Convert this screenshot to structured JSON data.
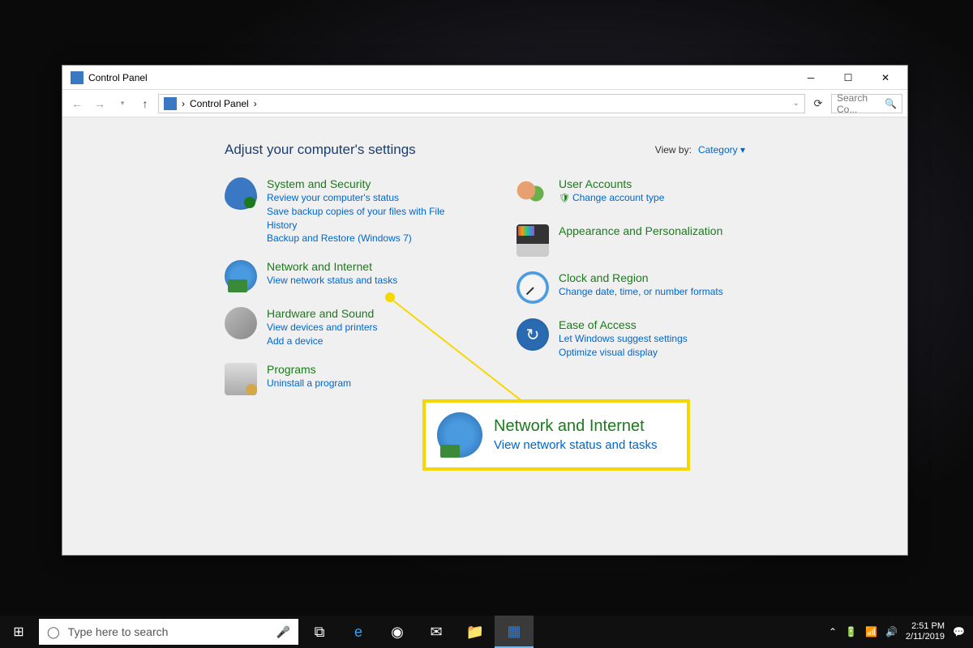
{
  "window": {
    "title": "Control Panel",
    "breadcrumb": "Control Panel",
    "search_placeholder": "Search Co..."
  },
  "content": {
    "heading": "Adjust your computer's settings",
    "viewby_label": "View by:",
    "viewby_value": "Category"
  },
  "categories": {
    "left": [
      {
        "title": "System and Security",
        "links": [
          "Review your computer's status",
          "Save backup copies of your files with File History",
          "Backup and Restore (Windows 7)"
        ]
      },
      {
        "title": "Network and Internet",
        "links": [
          "View network status and tasks"
        ]
      },
      {
        "title": "Hardware and Sound",
        "links": [
          "View devices and printers",
          "Add a device"
        ]
      },
      {
        "title": "Programs",
        "links": [
          "Uninstall a program"
        ]
      }
    ],
    "right": [
      {
        "title": "User Accounts",
        "links": [
          "Change account type"
        ],
        "shield": true
      },
      {
        "title": "Appearance and Personalization",
        "links": []
      },
      {
        "title": "Clock and Region",
        "links": [
          "Change date, time, or number formats"
        ]
      },
      {
        "title": "Ease of Access",
        "links": [
          "Let Windows suggest settings",
          "Optimize visual display"
        ]
      }
    ]
  },
  "callout": {
    "title": "Network and Internet",
    "link": "View network status and tasks"
  },
  "taskbar": {
    "search_placeholder": "Type here to search",
    "time": "2:51 PM",
    "date": "2/11/2019"
  }
}
